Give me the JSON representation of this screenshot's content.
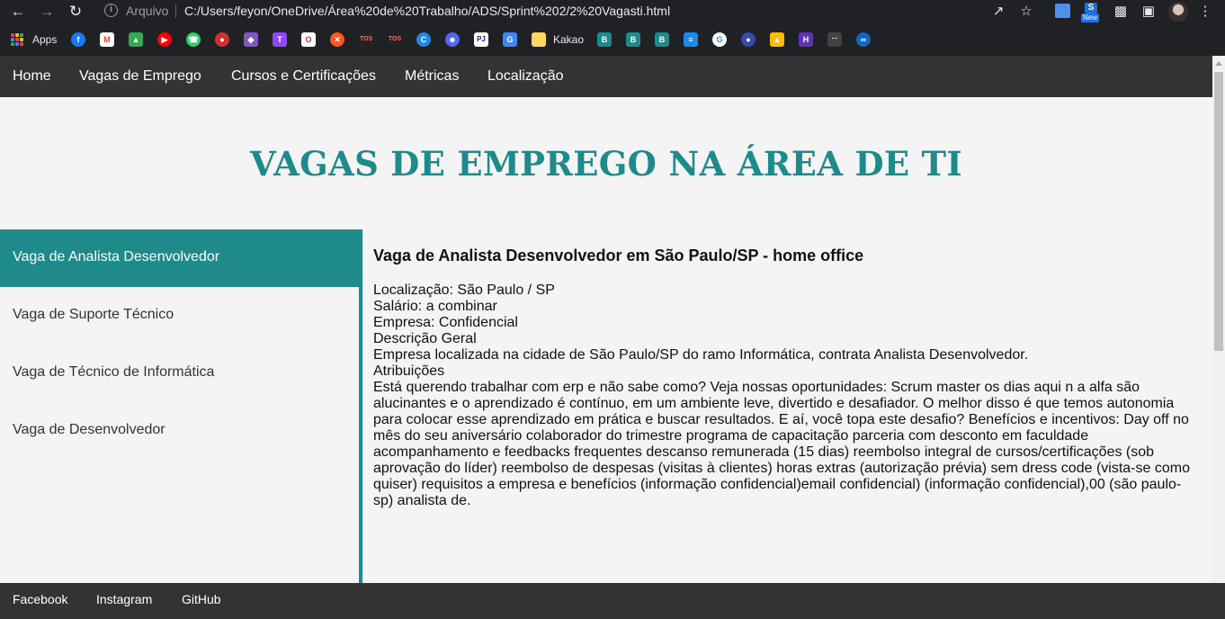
{
  "browser": {
    "arquivo_label": "Arquivo",
    "url": "C:/Users/feyon/OneDrive/Área%20de%20Trabalho/ADS/Sprint%202/2%20Vagasti.html",
    "new_badge": "New",
    "apps_label": "Apps",
    "kakao_label": "Kakao"
  },
  "nav": {
    "items": [
      "Home",
      "Vagas de Emprego",
      "Cursos e Certificações",
      "Métricas",
      "Localização"
    ]
  },
  "page": {
    "title": "VAGAS DE EMPREGO NA ÁREA DE TI"
  },
  "sidebar": {
    "items": [
      "Vaga de Analista Desenvolvedor",
      "Vaga de Suporte Técnico",
      "Vaga de Técnico de Informática",
      "Vaga de Desenvolvedor"
    ],
    "active_index": 0
  },
  "content": {
    "title": "Vaga de Analista Desenvolvedor em São Paulo/SP - home office",
    "lines": [
      "Localização: São Paulo / SP",
      "Salário: a combinar",
      "Empresa: Confidencial",
      "Descrição Geral",
      "Empresa localizada na cidade de São Paulo/SP do ramo Informática, contrata Analista Desenvolvedor.",
      "Atribuições",
      "Está querendo trabalhar com erp e não sabe como? Veja nossas oportunidades: Scrum master os dias aqui n a alfa são",
      "alucinantes e o aprendizado é contínuo, em um ambiente leve, divertido e desafiador. O melhor disso é que temos autonomia",
      "para colocar esse aprendizado em prática e buscar resultados. E aí, você topa este desafio? Benefícios e incentivos: Day off no",
      "mês do seu aniversário colaborador do trimestre programa de capacitação parceria com desconto em faculdade",
      "acompanhamento e feedbacks frequentes descanso remunerada (15 dias) reembolso integral de cursos/certificações (sob",
      "aprovação do líder) reembolso de despesas (visitas à clientes) horas extras (autorização prévia) sem dress code (vista-se como",
      "quiser) requisitos a empresa e benefícios (informação confidencial)email confidencial) (informação confidencial),00 (são paulo-",
      "sp) analista de."
    ]
  },
  "footer": {
    "items": [
      "Facebook",
      "Instagram",
      "GitHub"
    ]
  },
  "colors": {
    "accent": "#1f8a8a",
    "nav_bg": "#333333",
    "page_bg": "#f4f4f4"
  }
}
